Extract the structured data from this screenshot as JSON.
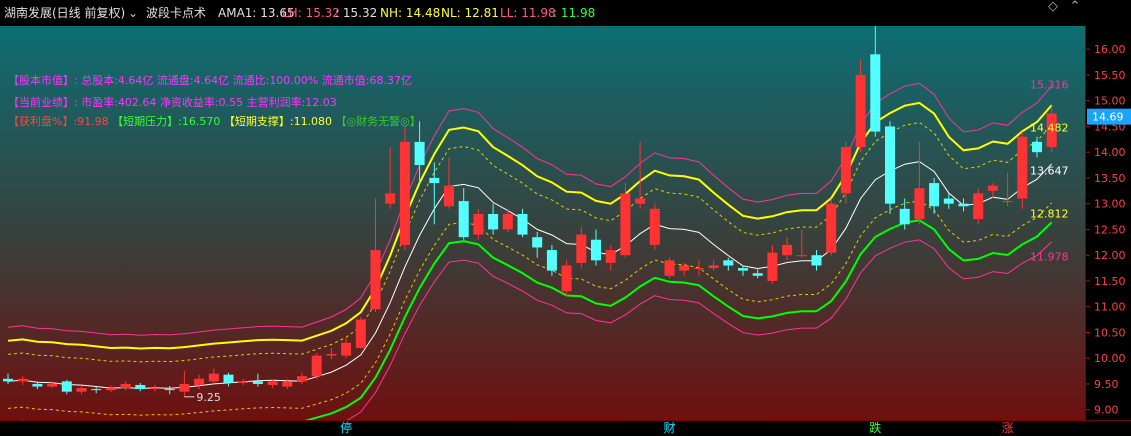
{
  "header": {
    "stock_name": "湖南发展(日线 前复权)",
    "indicator_name": "波段卡点术",
    "ama1": "AMA1: 13.65",
    "lh": "LH: 15.32",
    "lh_value": ": 15.32",
    "nh": "NH: 14.48",
    "nl": "NL: 12.81",
    "ll": "LL: 11.98",
    "ll_value": ": 11.98"
  },
  "info": {
    "line1_tag": "【股本市值】:",
    "line1_text": "总股本:4.64亿 流通盘:4.64亿 流通比:100.00% 流通市值:68.37亿",
    "line2_tag": "【当前业绩】:",
    "line2_text": "市盈率:402.64 净资收益率:0.55 主营利润率:12.03",
    "profit_label": "【获利盘%】",
    "profit_value": ":91.98",
    "pressure_label": "【短期压力】",
    "pressure_value": ":16.570",
    "support_label": "【短期支撑】",
    "support_value": ":11.080",
    "no_warning": "【◎财务无警◎】"
  },
  "markers": [
    {
      "label": "停",
      "index": 23
    },
    {
      "label": "财",
      "index": 45
    },
    {
      "label": "跌",
      "index": 59
    },
    {
      "label": "涨",
      "index": 68
    }
  ],
  "colors": {
    "up": "#ff3333",
    "down": "#54ffff",
    "band_outer_top": "#ffff00",
    "band_outer_bottom": "#00ff00",
    "band_channel": "#ff3399",
    "band_inner": "#e0d000",
    "band_mid": "#ffffff",
    "header_text": "#e0e0e0",
    "info_magenta": "#ff33ff",
    "info_yellow": "#ffff33",
    "info_red": "#ff4444",
    "info_green": "#33ff33"
  },
  "chart_data": {
    "type": "candlestick",
    "y_axis": {
      "min": 8.8,
      "max": 16.45,
      "ticks": [
        "9.00",
        "9.50",
        "10.00",
        "10.50",
        "11.00",
        "11.50",
        "12.00",
        "12.50",
        "13.00",
        "13.50",
        "14.00",
        "14.50",
        "15.00",
        "15.50",
        "16.00"
      ]
    },
    "current_price": "14.69",
    "annotations": {
      "high": "16.57",
      "low": "9.25"
    },
    "right_labels": [
      {
        "text": "15.316",
        "value": 15.316,
        "color": "#ff3399"
      },
      {
        "text": "14.482",
        "value": 14.482,
        "color": "#ffff33"
      },
      {
        "text": "13.647",
        "value": 13.647,
        "color": "#ffffff"
      },
      {
        "text": "12.812",
        "value": 12.812,
        "color": "#ffff33"
      },
      {
        "text": "11.978",
        "value": 11.978,
        "color": "#ff3399"
      }
    ],
    "candles": [
      [
        9.6,
        9.55,
        9.7,
        9.5
      ],
      [
        9.55,
        9.6,
        9.65,
        9.48
      ],
      [
        9.5,
        9.45,
        9.55,
        9.4
      ],
      [
        9.45,
        9.5,
        9.55,
        9.42
      ],
      [
        9.55,
        9.35,
        9.58,
        9.3
      ],
      [
        9.35,
        9.42,
        9.45,
        9.3
      ],
      [
        9.4,
        9.38,
        9.45,
        9.32
      ],
      [
        9.38,
        9.42,
        9.47,
        9.34
      ],
      [
        9.42,
        9.5,
        9.55,
        9.38
      ],
      [
        9.48,
        9.4,
        9.52,
        9.36
      ],
      [
        9.4,
        9.42,
        9.48,
        9.35
      ],
      [
        9.4,
        9.38,
        9.46,
        9.3
      ],
      [
        9.35,
        9.5,
        9.75,
        9.25
      ],
      [
        9.48,
        9.6,
        9.68,
        9.4
      ],
      [
        9.55,
        9.7,
        9.8,
        9.5
      ],
      [
        9.68,
        9.52,
        9.72,
        9.45
      ],
      [
        9.52,
        9.55,
        9.6,
        9.48
      ],
      [
        9.55,
        9.5,
        9.7,
        9.45
      ],
      [
        9.48,
        9.55,
        9.58,
        9.42
      ],
      [
        9.45,
        9.55,
        9.6,
        9.4
      ],
      [
        9.55,
        9.65,
        9.72,
        9.5
      ],
      [
        9.65,
        10.05,
        10.1,
        9.6
      ],
      [
        10.05,
        10.08,
        10.2,
        9.98
      ],
      [
        10.05,
        10.3,
        10.38,
        10.0
      ],
      [
        10.2,
        10.75,
        10.8,
        10.18
      ],
      [
        10.95,
        12.1,
        13.1,
        10.9
      ],
      [
        13.0,
        13.2,
        14.1,
        12.9
      ],
      [
        12.2,
        14.2,
        14.5,
        12.1
      ],
      [
        14.2,
        13.75,
        14.6,
        13.4
      ],
      [
        13.5,
        13.4,
        13.8,
        12.6
      ],
      [
        12.95,
        13.35,
        13.9,
        12.9
      ],
      [
        13.05,
        12.35,
        13.3,
        12.3
      ],
      [
        12.4,
        12.8,
        12.9,
        12.3
      ],
      [
        12.8,
        12.5,
        13.0,
        12.4
      ],
      [
        12.5,
        12.8,
        12.9,
        12.45
      ],
      [
        12.8,
        12.4,
        12.9,
        12.35
      ],
      [
        12.35,
        12.15,
        12.45,
        11.95
      ],
      [
        12.1,
        11.7,
        12.2,
        11.6
      ],
      [
        11.3,
        11.8,
        11.9,
        11.2
      ],
      [
        11.85,
        12.4,
        12.55,
        11.75
      ],
      [
        12.3,
        11.9,
        12.5,
        11.8
      ],
      [
        11.85,
        12.1,
        12.2,
        11.7
      ],
      [
        12.0,
        13.2,
        13.4,
        11.95
      ],
      [
        13.0,
        13.1,
        14.2,
        12.9
      ],
      [
        12.2,
        12.9,
        13.0,
        12.1
      ],
      [
        11.6,
        11.9,
        11.95,
        11.55
      ],
      [
        11.7,
        11.8,
        11.85,
        11.6
      ],
      [
        11.75,
        11.75,
        11.9,
        11.6
      ],
      [
        11.75,
        11.8,
        11.9,
        11.7
      ],
      [
        11.9,
        11.8,
        11.95,
        11.7
      ],
      [
        11.75,
        11.7,
        11.8,
        11.6
      ],
      [
        11.65,
        11.6,
        11.75,
        11.55
      ],
      [
        11.5,
        12.05,
        12.2,
        11.45
      ],
      [
        12.0,
        12.2,
        12.35,
        11.9
      ],
      [
        12.0,
        12.0,
        12.5,
        11.95
      ],
      [
        12.0,
        11.8,
        12.1,
        11.7
      ],
      [
        12.05,
        13.0,
        13.1,
        12.0
      ],
      [
        13.2,
        14.1,
        14.2,
        13.0
      ],
      [
        14.1,
        15.5,
        15.8,
        14.0
      ],
      [
        15.9,
        14.4,
        16.57,
        14.3
      ],
      [
        14.5,
        13.0,
        14.6,
        12.8
      ],
      [
        12.9,
        12.6,
        13.1,
        12.5
      ],
      [
        12.7,
        13.3,
        14.2,
        12.6
      ],
      [
        13.4,
        12.95,
        13.5,
        12.8
      ],
      [
        13.1,
        13.0,
        13.2,
        12.9
      ],
      [
        13.0,
        12.95,
        13.1,
        12.85
      ],
      [
        12.7,
        13.2,
        13.3,
        12.6
      ],
      [
        13.25,
        13.35,
        13.4,
        13.1
      ],
      [
        13.05,
        13.05,
        13.6,
        12.95
      ],
      [
        13.1,
        14.3,
        14.4,
        12.9
      ],
      [
        14.2,
        14.0,
        14.3,
        13.9
      ],
      [
        14.1,
        14.75,
        14.9,
        14.0
      ]
    ]
  }
}
